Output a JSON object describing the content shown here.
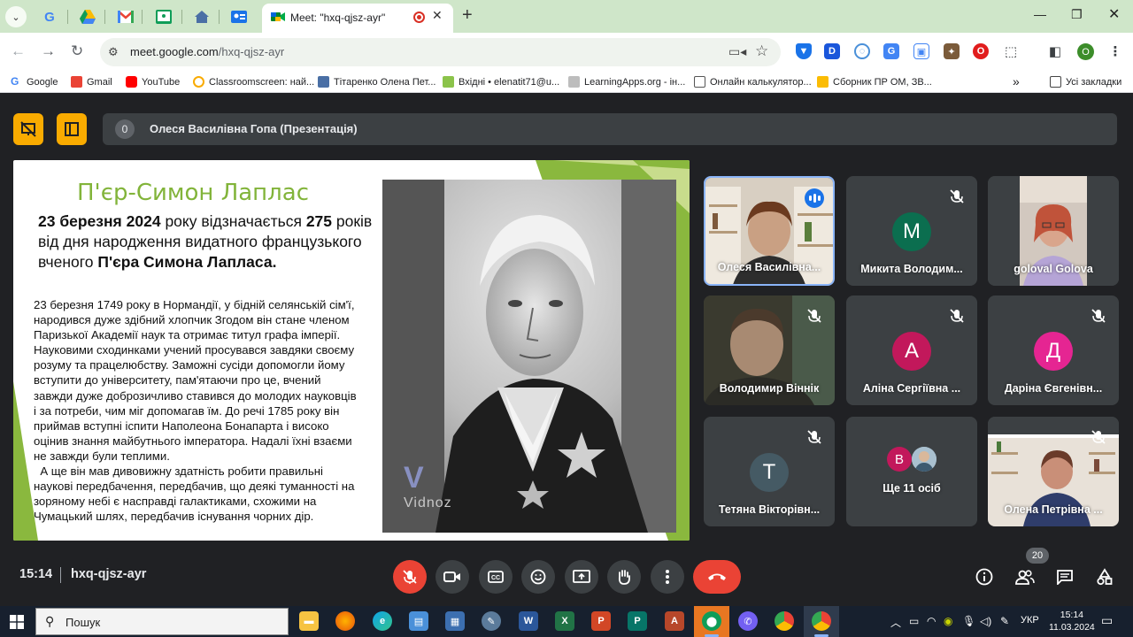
{
  "browser": {
    "active_tab_title": "Meet: \"hxq-qjsz-ayr\"",
    "url_host": "meet.google.com",
    "url_path": "/hxq-qjsz-ayr",
    "profile_initial": "O",
    "bookmarks": [
      {
        "label": "Google",
        "icon": "google-icon",
        "color": "#4285f4"
      },
      {
        "label": "Gmail",
        "icon": "gmail-icon",
        "color": "#ea4335"
      },
      {
        "label": "YouTube",
        "icon": "youtube-icon",
        "color": "#ff0000"
      },
      {
        "label": "Classroomscreen: най...",
        "icon": "classroomscreen-icon",
        "color": "#f9ab00"
      },
      {
        "label": "Тітаренко Олена Пет...",
        "icon": "site-icon",
        "color": "#4a6fa5"
      },
      {
        "label": "Вхідні • elenatit71@u...",
        "icon": "mail-icon",
        "color": "#8bc34a"
      },
      {
        "label": "LearningApps.org - ін...",
        "icon": "learningapps-icon",
        "color": "#7a7a7a"
      },
      {
        "label": "Онлайн калькулятор...",
        "icon": "calculator-icon",
        "color": "#555555"
      },
      {
        "label": "Сборник ПР ОМ, ЗВ...",
        "icon": "drive-icon",
        "color": "#fbbc04"
      }
    ],
    "all_bookmarks_label": "Усі закладки"
  },
  "meet": {
    "presenter_count": "0",
    "presenter_name": "Олеся Василівна Гопа (Презентація)",
    "slide": {
      "title": "П'єр-Симон Лаплас",
      "lead_date": "23 березня 2024",
      "lead_mid": " року відзначається ",
      "lead_num": "275",
      "lead_rest": " років від дня народження видатного французького вченого ",
      "lead_name": "П'єра Симона Лапласа",
      "lead_end": ".",
      "body_lines": [
        "23 березня 1749 року в Нормандії, у бідній селянській сім'ї,",
        "народився дуже здібний хлопчик Згодом він стане членом",
        "Паризької Академії наук та отримає титул графа імперії.",
        "Науковими сходинками учений просувався завдяки своєму",
        "розуму та працелюбству. Заможні сусіди допомогли йому",
        "вступити до університету, пам'ятаючи про це, вчений",
        "завжди дуже доброзичливо ставився до молодих науковців",
        "і за потреби, чим міг допомагав їм. До речі 1785 року він",
        "приймав вступні іспити Наполеона Бонапарта і високо",
        "оцінив знання майбутнього імператора. Надалі їхні взаєми",
        "не завжди були теплими.",
        "  А ще він мав дивовижну здатність робити правильні",
        "наукові передбачення, передбачив, що деякі туманності на",
        "зоряному небі є насправді галактиками, схожими на",
        "Чумацький шлях, передбачив існування чорних дір."
      ],
      "watermark": "Vidnoz"
    },
    "participants": [
      {
        "name": "Олеся Василівна...",
        "type": "video",
        "speaking": true,
        "muted": false
      },
      {
        "name": "Микита Володим...",
        "type": "avatar",
        "initial": "M",
        "color": "#0b6e4f",
        "muted": true
      },
      {
        "name": "goloval Golova",
        "type": "video",
        "speaking": false,
        "muted": false
      },
      {
        "name": "Володимир Віннік",
        "type": "video",
        "speaking": false,
        "muted": true
      },
      {
        "name": "Аліна Сергіївна ...",
        "type": "avatar",
        "initial": "A",
        "color": "#c2185b",
        "muted": true
      },
      {
        "name": "Даріна Євгенівн...",
        "type": "avatar",
        "initial": "Д",
        "color": "#e52592",
        "muted": true
      },
      {
        "name": "Тетяна Вікторівн...",
        "type": "avatar",
        "initial": "T",
        "color": "#455a64",
        "muted": true
      },
      {
        "name": "Ще 11 осіб",
        "type": "more",
        "initial": "B",
        "color": "#c2185b"
      },
      {
        "name": "Олена Петрівна ...",
        "type": "video",
        "speaking": false,
        "muted": true
      }
    ],
    "callbar": {
      "time": "15:14",
      "meeting_code": "hxq-qjsz-ayr",
      "people_count": "20"
    }
  },
  "taskbar": {
    "search_placeholder": "Пошук",
    "language": "УКР",
    "time": "15:14",
    "date": "11.03.2024"
  }
}
